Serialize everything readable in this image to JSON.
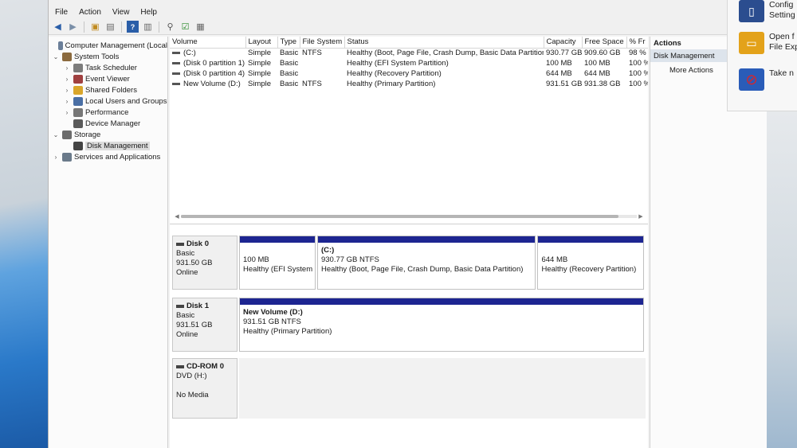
{
  "menu": [
    "File",
    "Action",
    "View",
    "Help"
  ],
  "tree": [
    {
      "label": "Computer Management (Local",
      "chev": "",
      "indent": 0,
      "icon": "computer-icon",
      "color": "#6b7f99"
    },
    {
      "label": "System Tools",
      "chev": "⌄",
      "indent": 0,
      "icon": "tools-icon",
      "color": "#8b6a3e"
    },
    {
      "label": "Task Scheduler",
      "chev": "›",
      "indent": 1,
      "icon": "clock-icon",
      "color": "#7c7c7c"
    },
    {
      "label": "Event Viewer",
      "chev": "›",
      "indent": 1,
      "icon": "event-viewer-icon",
      "color": "#a04040"
    },
    {
      "label": "Shared Folders",
      "chev": "›",
      "indent": 1,
      "icon": "folder-icon",
      "color": "#d9a62b"
    },
    {
      "label": "Local Users and Groups",
      "chev": "›",
      "indent": 1,
      "icon": "users-icon",
      "color": "#4a6fa5"
    },
    {
      "label": "Performance",
      "chev": "›",
      "indent": 1,
      "icon": "performance-icon",
      "color": "#777777"
    },
    {
      "label": "Device Manager",
      "chev": "",
      "indent": 1,
      "icon": "device-manager-icon",
      "color": "#5a5a5a"
    },
    {
      "label": "Storage",
      "chev": "⌄",
      "indent": 0,
      "icon": "storage-icon",
      "color": "#6c6c6c"
    },
    {
      "label": "Disk Management",
      "chev": "",
      "indent": 1,
      "icon": "disk-icon",
      "color": "#444444",
      "selected": true
    },
    {
      "label": "Services and Applications",
      "chev": "›",
      "indent": 0,
      "icon": "services-icon",
      "color": "#6a7a8a"
    }
  ],
  "table": {
    "headers": [
      "Volume",
      "Layout",
      "Type",
      "File System",
      "Status",
      "Capacity",
      "Free Space",
      "% Fr"
    ],
    "rows": [
      [
        "(C:)",
        "Simple",
        "Basic",
        "NTFS",
        "Healthy (Boot, Page File, Crash Dump, Basic Data Partition)",
        "930.77 GB",
        "909.60 GB",
        "98 %"
      ],
      [
        "(Disk 0 partition 1)",
        "Simple",
        "Basic",
        "",
        "Healthy (EFI System Partition)",
        "100 MB",
        "100 MB",
        "100 %"
      ],
      [
        "(Disk 0 partition 4)",
        "Simple",
        "Basic",
        "",
        "Healthy (Recovery Partition)",
        "644 MB",
        "644 MB",
        "100 %"
      ],
      [
        "New Volume (D:)",
        "Simple",
        "Basic",
        "NTFS",
        "Healthy (Primary Partition)",
        "931.51 GB",
        "931.38 GB",
        "100 %"
      ]
    ]
  },
  "disks": [
    {
      "name": "Disk 0",
      "type": "Basic",
      "size": "931.50 GB",
      "state": "Online",
      "partitions": [
        {
          "name": "",
          "size": "100 MB",
          "status": "Healthy (EFI System",
          "flex": 1
        },
        {
          "name": "(C:)",
          "size": "930.77 GB NTFS",
          "status": "Healthy (Boot, Page File, Crash Dump, Basic Data Partition)",
          "flex": 2.9
        },
        {
          "name": "",
          "size": "644 MB",
          "status": "Healthy (Recovery Partition)",
          "flex": 1.4
        }
      ]
    },
    {
      "name": "Disk 1",
      "type": "Basic",
      "size": "931.51 GB",
      "state": "Online",
      "partitions": [
        {
          "name": "New Volume  (D:)",
          "size": "931.51 GB NTFS",
          "status": "Healthy (Primary Partition)",
          "flex": 1
        }
      ]
    }
  ],
  "cdrom": {
    "name": "CD-ROM 0",
    "type": "DVD (H:)",
    "media": "No Media"
  },
  "actions": {
    "header": "Actions",
    "selected": "Disk Management",
    "more": "More Actions"
  },
  "popup": [
    {
      "line1": "Config",
      "line2": "Setting",
      "icon": "settings-icon",
      "color": "#2b4d8f"
    },
    {
      "line1": "Open f",
      "line2": "File Exp",
      "icon": "file-explorer-icon",
      "color": "#e3a21a"
    },
    {
      "line1": "Take n",
      "line2": "",
      "icon": "blocked-icon",
      "color": "#2a5cb8"
    }
  ]
}
